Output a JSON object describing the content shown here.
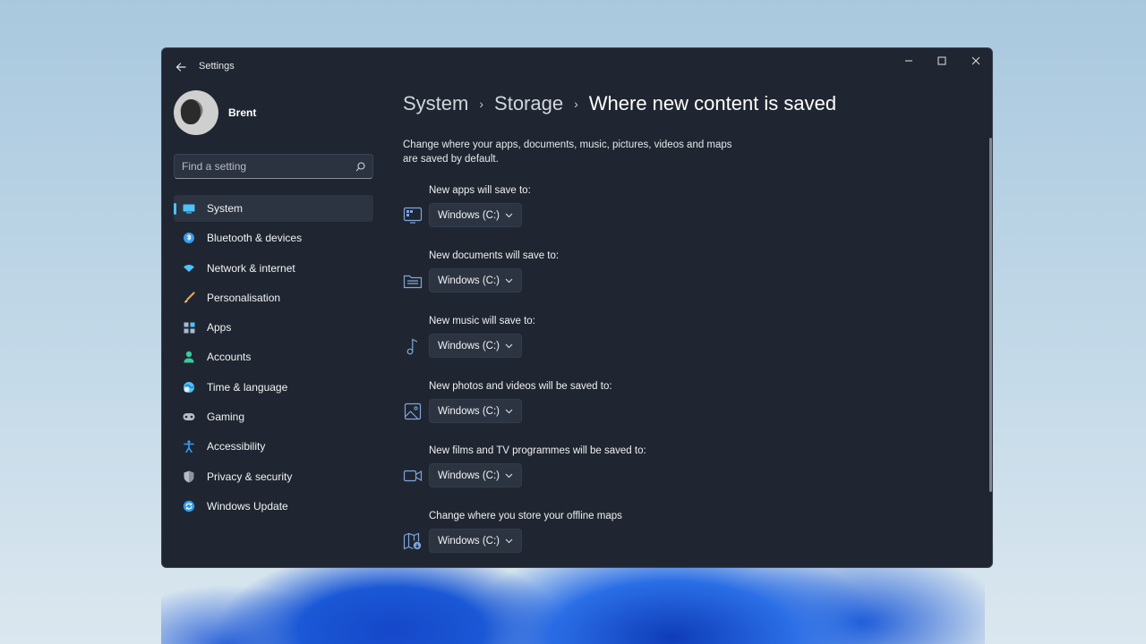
{
  "window": {
    "app_title": "Settings",
    "controls": {
      "minimize": "—",
      "maximize": "☐",
      "close": "✕"
    }
  },
  "profile": {
    "name": "Brent"
  },
  "search": {
    "placeholder": "Find a setting"
  },
  "sidebar": {
    "items": [
      {
        "label": "System",
        "icon": "system-icon",
        "color": "#4cc2ff",
        "active": true
      },
      {
        "label": "Bluetooth & devices",
        "icon": "bluetooth-icon",
        "color": "#3a9bf0"
      },
      {
        "label": "Network & internet",
        "icon": "wifi-icon",
        "color": "#4cc2ff"
      },
      {
        "label": "Personalisation",
        "icon": "brush-icon",
        "color": "#e8a64c"
      },
      {
        "label": "Apps",
        "icon": "apps-icon",
        "color": "#a9b9d0"
      },
      {
        "label": "Accounts",
        "icon": "accounts-icon",
        "color": "#3cc7a0"
      },
      {
        "label": "Time & language",
        "icon": "globe-icon",
        "color": "#4cc2ff"
      },
      {
        "label": "Gaming",
        "icon": "gamepad-icon",
        "color": "#b8bcc4"
      },
      {
        "label": "Accessibility",
        "icon": "accessibility-icon",
        "color": "#3a9bf0"
      },
      {
        "label": "Privacy & security",
        "icon": "shield-icon",
        "color": "#b8bcc4"
      },
      {
        "label": "Windows Update",
        "icon": "update-icon",
        "color": "#2f9be8"
      }
    ]
  },
  "breadcrumb": {
    "system": "System",
    "storage": "Storage",
    "current": "Where new content is saved",
    "separator": "›"
  },
  "description": "Change where your apps, documents, music, pictures, videos and maps are saved by default.",
  "save_locations": [
    {
      "label": "New apps will save to:",
      "value": "Windows (C:)",
      "icon": "apps-window-icon"
    },
    {
      "label": "New documents will save to:",
      "value": "Windows (C:)",
      "icon": "documents-folder-icon"
    },
    {
      "label": "New music will save to:",
      "value": "Windows (C:)",
      "icon": "music-note-icon"
    },
    {
      "label": "New photos and videos will be saved to:",
      "value": "Windows (C:)",
      "icon": "photo-icon"
    },
    {
      "label": "New films and TV programmes will be saved to:",
      "value": "Windows (C:)",
      "icon": "video-camera-icon"
    },
    {
      "label": "Change where you store your offline maps",
      "value": "Windows (C:)",
      "icon": "offline-maps-icon"
    }
  ],
  "colors": {
    "accent": "#4cc2ff",
    "window_bg": "#1f2631",
    "icon_outline": "#7fa6d9"
  }
}
